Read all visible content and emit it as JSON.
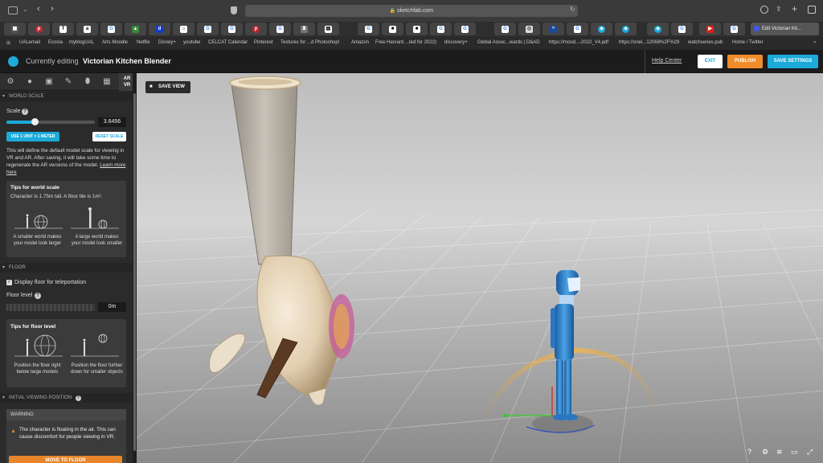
{
  "browser": {
    "url": "sketchfab.com",
    "tabs": [
      "T",
      "a",
      "G",
      "G",
      "G",
      "G",
      "G",
      "G",
      "G",
      "G",
      "G",
      "G",
      "G"
    ],
    "active_tab": "Edit Victorian Kit...",
    "bookmarks": [
      "UALemail",
      "Ecosia",
      "myblogUAL",
      "Arts Moodle",
      "Netflix",
      "Disney+",
      "youtube",
      "CELCAT Calendar",
      "Pinterest",
      "Textures for ...d Photoshop!",
      "Amazon",
      "Free Harvard ...ted for 2022)",
      "discovery+",
      "Global Assoc...wards | D&AD",
      "https://mood...-2022_V4.pdf",
      "https://onei...12068%2F%29",
      "watchseries.pub",
      "Home / Twitter"
    ]
  },
  "header": {
    "editing_prefix": "Currently editing",
    "model_name": "Victorian Kitchen Blender",
    "help": "Help Center",
    "exit": "EXIT",
    "publish": "PUBLISH",
    "save": "SAVE SETTINGS"
  },
  "tools": {
    "ar_label": "AR\nVR"
  },
  "world_scale": {
    "title": "WORLD SCALE",
    "scale_label": "Scale",
    "scale_value": "3.6456",
    "slider_fraction": 0.32,
    "btn_unit": "USE 1 UNIT = 1 METER",
    "btn_reset": "RESET SCALE",
    "description": "This will define the default model scale for viewing in VR and AR. After saving, it will take some time to regenerate the AR versions of the model.",
    "learn_more": "Learn more here",
    "tips_title": "Tips for world scale",
    "tips_text": "Character is 1.75m tall. A floor tile is 1m².",
    "tip_small": "A smaller world makes your model look larger",
    "tip_large": "A large world makes your model look smaller"
  },
  "floor": {
    "title": "FLOOR",
    "checkbox_label": "Display floor for teleportation",
    "level_label": "Floor level",
    "level_value": "0m",
    "tips_title": "Tips for floor level",
    "tip_below": "Position the floor right below large models",
    "tip_further": "Position the floor further down for smaller objects"
  },
  "initial_view": {
    "title": "INITIAL VIEWING POSITION",
    "warning_title": "WARNING",
    "warning_text": "The character is floating in the air. This can cause discomfort for people viewing in VR.",
    "move_btn": "MOVE TO FLOOR"
  },
  "viewport": {
    "save_view": "SAVE VIEW",
    "bottom_icons": [
      "?",
      "gear",
      "layers",
      "vr",
      "fullscreen"
    ]
  },
  "colors": {
    "accent_blue": "#1caad9",
    "publish_orange": "#f08c2a",
    "warning_orange": "#e8852a"
  }
}
